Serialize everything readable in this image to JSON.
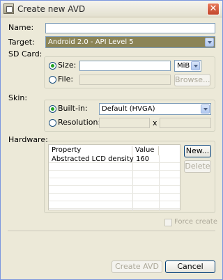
{
  "window": {
    "title": "Create new AVD"
  },
  "form": {
    "name_label": "Name:",
    "name_value": "",
    "target_label": "Target:",
    "target_value": "Android 2.0 - API Level 5",
    "sdcard_label": "SD Card:",
    "size_label": "Size:",
    "size_value": "",
    "size_unit": "MiB",
    "file_label": "File:",
    "file_value": "",
    "browse_label": "Browse...",
    "skin_label": "Skin:",
    "builtin_label": "Built-in:",
    "builtin_value": "Default (HVGA)",
    "resolution_label": "Resolution:",
    "resolution_width": "",
    "resolution_sep": "x",
    "resolution_height": "",
    "hardware_label": "Hardware:"
  },
  "hardware_table": {
    "columns": [
      "Property",
      "Value"
    ],
    "rows": [
      {
        "property": "Abstracted LCD density",
        "value": "160"
      }
    ]
  },
  "hardware_buttons": {
    "new_label": "New...",
    "delete_label": "Delete"
  },
  "force_create_label": "Force create",
  "footer": {
    "create_label": "Create AVD",
    "cancel_label": "Cancel"
  }
}
